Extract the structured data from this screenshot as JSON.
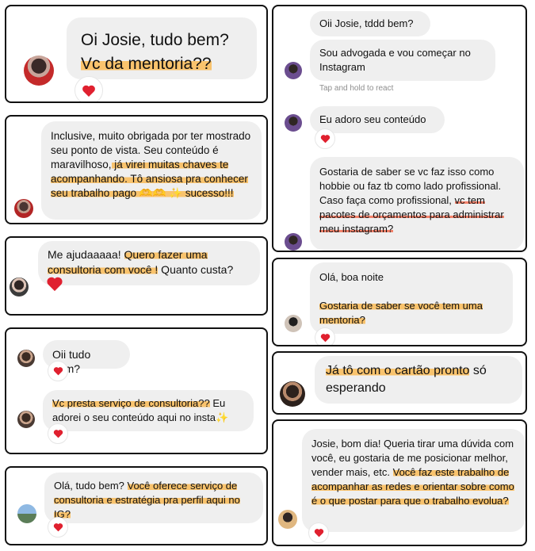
{
  "colors": {
    "highlight_orange": "#f9c36d",
    "highlight_red": "#f2826b",
    "bubble": "#efefef",
    "heart": "#e0202f"
  },
  "icons": {
    "reaction": "heart-icon"
  },
  "panels": {
    "p1": {
      "greeting": "Oi Josie, tudo bem?",
      "question": "Vc da mentoria??"
    },
    "p2": {
      "t1": "Inclusive, muito obrigada por ter mostrado seu ponto de vista. Seu conteúdo é maravilhoso,",
      "t2": " já virei muitas chaves te acompanhando. Tô ansiosa pra conhecer seu trabalho pago 🫶🫶 ✨ sucesso!!!"
    },
    "p3": {
      "t1": "Me ajudaaaaa! ",
      "t2": "Quero fazer uma consultoria com você !",
      "t3": " Quanto custa?"
    },
    "p4": {
      "m1": "Oii tudo bem?",
      "m2a": "Vc presta serviço de consultoria??",
      "m2b": " Eu adorei o seu conteúdo aqui no insta✨"
    },
    "p5": {
      "t1": "Olá, tudo bem? ",
      "t2": "Você oferece serviço de consultoria e estratégia pra perfil aqui no IG?"
    },
    "p6": {
      "m1": "Oii Josie, tddd bem?",
      "m2": "Sou advogada e vou começar no Instagram",
      "hint": "Tap and hold to react",
      "m3": "Eu adoro seu conteúdo",
      "m4a": "Gostaria de saber se vc faz isso como hobbie ou faz tb como lado profissional. Caso faça como profissional, ",
      "m4b": "vc tem pacotes de orçamentos para administrar meu instagram?"
    },
    "p7": {
      "t1": "Olá, boa noite",
      "t2": "Gostaria de saber se você tem uma mentoria?"
    },
    "p8": {
      "t1": "Já tô com o cartão pronto",
      "t2": " só esperando"
    },
    "p9": {
      "t1": "Josie, bom dia! Queria tirar uma dúvida com você, eu gostaria de me posicionar melhor, vender mais, etc. ",
      "t2": "Você faz este trabalho de acompanhar as redes e orientar sobre como é o que postar para que o trabalho evolua?"
    }
  }
}
